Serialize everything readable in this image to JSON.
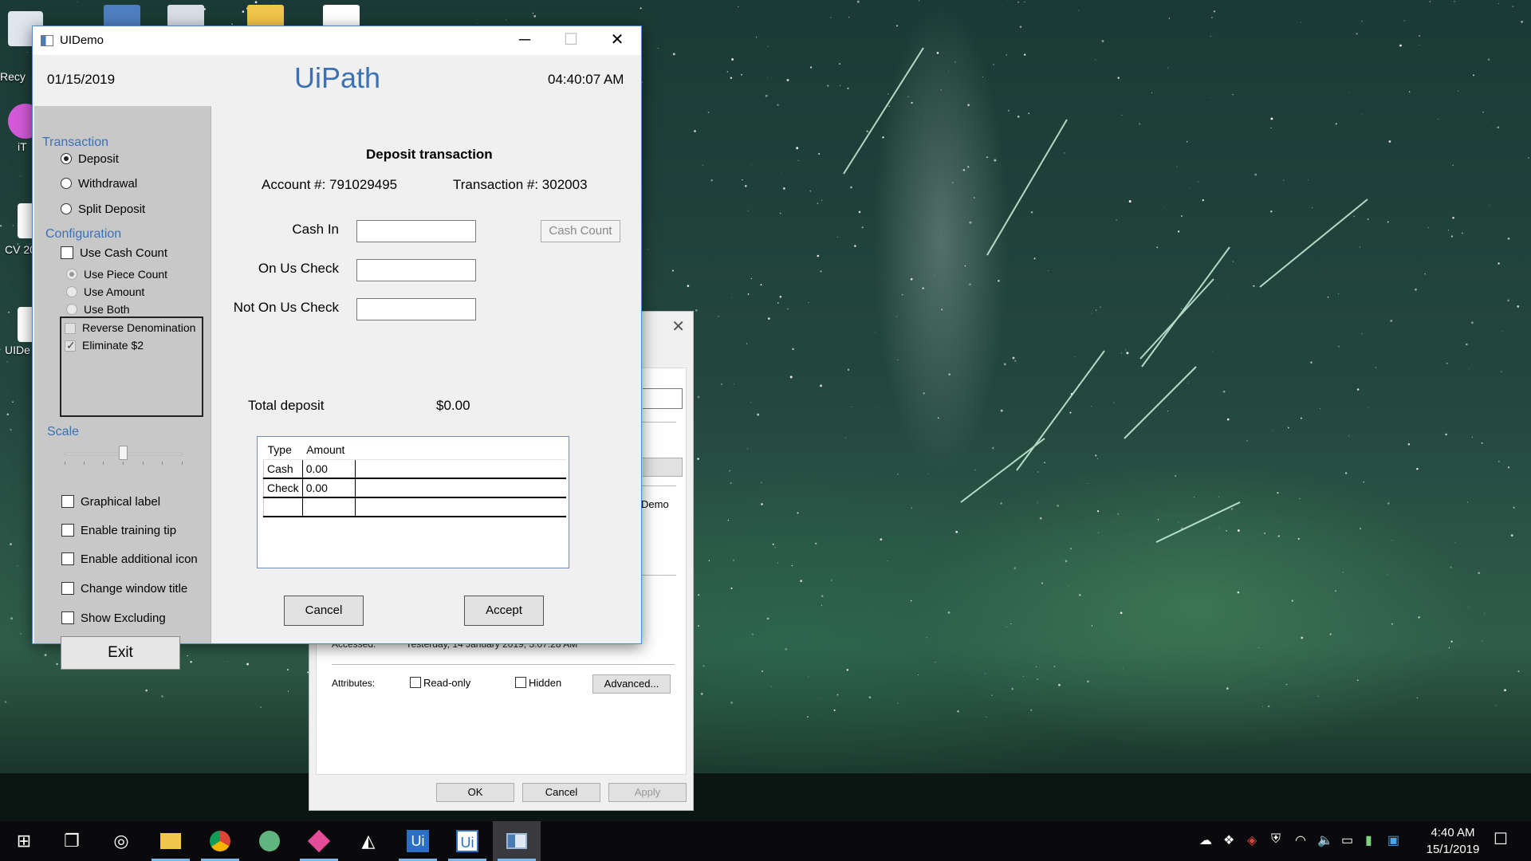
{
  "desktop": {
    "icons": [
      {
        "label": "Recy",
        "icon": "recycle-bin-icon"
      },
      {
        "label": "iT",
        "icon": "itunes-icon"
      },
      {
        "label": "CV 20",
        "icon": "pdf-file-icon"
      },
      {
        "label": "UIDe",
        "icon": "uidemo-shortcut-icon"
      }
    ]
  },
  "properties_dialog": {
    "accessed_label": "Accessed:",
    "accessed_value": "Yesterday, 14 January 2019, 3:07:28 AM",
    "attributes_label": "Attributes:",
    "readonly_label": "Read-only",
    "hidden_label": "Hidden",
    "advanced_label": "Advanced...",
    "demo_fragment": "Demo",
    "ok_label": "OK",
    "cancel_label": "Cancel",
    "apply_label": "Apply"
  },
  "window": {
    "title": "UIDemo",
    "date": "01/15/2019",
    "brand": "UiPath",
    "time": "04:40:07 AM"
  },
  "sidebar": {
    "transaction_heading": "Transaction",
    "transaction_options": [
      "Deposit",
      "Withdrawal",
      "Split Deposit"
    ],
    "selected_transaction": "Deposit",
    "configuration_heading": "Configuration",
    "use_cash_count": "Use Cash Count",
    "count_options": [
      "Use Piece Count",
      "Use Amount",
      "Use Both"
    ],
    "reverse_denomination": "Reverse Denomination",
    "eliminate_2": "Eliminate $2",
    "scale_heading": "Scale",
    "scale_value": 0.5,
    "checkboxes": [
      "Graphical label",
      "Enable training tip",
      "Enable additional icon",
      "Change window title",
      "Show Excluding"
    ],
    "exit_label": "Exit"
  },
  "deposit": {
    "title": "Deposit transaction",
    "account": "Account #: 791029495",
    "transaction": "Transaction #: 302003",
    "cash_in_label": "Cash In",
    "on_us_check_label": "On Us Check",
    "not_on_us_check_label": "Not On Us Check",
    "cash_count_label": "Cash Count",
    "total_label": "Total deposit",
    "total_value": "$0.00",
    "table": {
      "headers": [
        "Type",
        "Amount"
      ],
      "rows": [
        {
          "type": "Cash",
          "amount": "0.00"
        },
        {
          "type": "Check",
          "amount": "0.00"
        }
      ]
    },
    "cancel_label": "Cancel",
    "accept_label": "Accept"
  },
  "taskbar": {
    "apps": [
      "start-icon",
      "task-view-icon",
      "cortana-icon",
      "file-explorer-icon",
      "chrome-icon",
      "atom-icon",
      "git-icon",
      "unity-icon",
      "uipath-studio-icon",
      "uipath-robot-icon",
      "uidemo-icon"
    ],
    "clock_time": "4:40 AM",
    "clock_date": "15/1/2019"
  }
}
